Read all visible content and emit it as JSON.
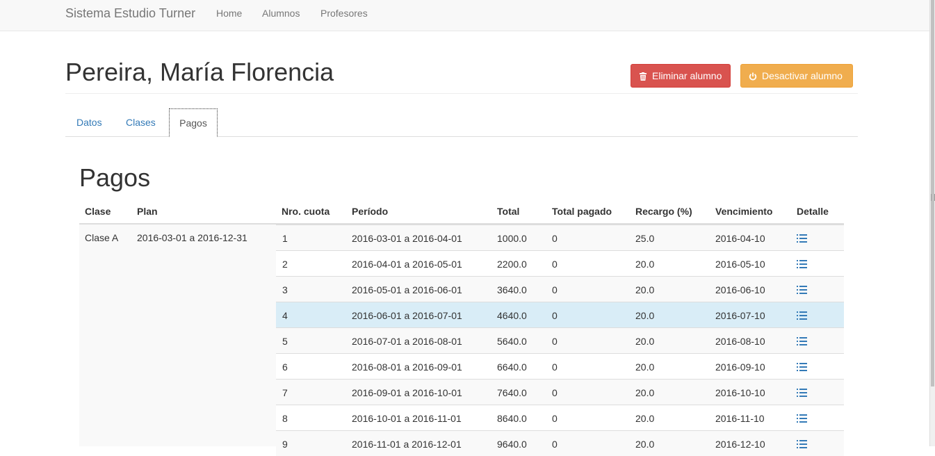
{
  "navbar": {
    "brand": "Sistema Estudio Turner",
    "links": [
      "Home",
      "Alumnos",
      "Profesores"
    ]
  },
  "header": {
    "title": "Pereira, María Florencia",
    "delete_label": "Eliminar alumno",
    "deactivate_label": "Desactivar alumno"
  },
  "tabs": [
    "Datos",
    "Clases",
    "Pagos"
  ],
  "active_tab": "Pagos",
  "section_title": "Pagos",
  "table": {
    "headers": [
      "Clase",
      "Plan",
      "Nro. cuota",
      "Período",
      "Total",
      "Total pagado",
      "Recargo (%)",
      "Vencimiento",
      "Detalle"
    ],
    "clase": "Clase A",
    "plan": "2016-03-01 a 2016-12-31",
    "rows": [
      {
        "nro": "1",
        "periodo": "2016-03-01 a 2016-04-01",
        "total": "1000.0",
        "pagado": "0",
        "recargo": "25.0",
        "vencimiento": "2016-04-10"
      },
      {
        "nro": "2",
        "periodo": "2016-04-01 a 2016-05-01",
        "total": "2200.0",
        "pagado": "0",
        "recargo": "20.0",
        "vencimiento": "2016-05-10"
      },
      {
        "nro": "3",
        "periodo": "2016-05-01 a 2016-06-01",
        "total": "3640.0",
        "pagado": "0",
        "recargo": "20.0",
        "vencimiento": "2016-06-10"
      },
      {
        "nro": "4",
        "periodo": "2016-06-01 a 2016-07-01",
        "total": "4640.0",
        "pagado": "0",
        "recargo": "20.0",
        "vencimiento": "2016-07-10"
      },
      {
        "nro": "5",
        "periodo": "2016-07-01 a 2016-08-01",
        "total": "5640.0",
        "pagado": "0",
        "recargo": "20.0",
        "vencimiento": "2016-08-10"
      },
      {
        "nro": "6",
        "periodo": "2016-08-01 a 2016-09-01",
        "total": "6640.0",
        "pagado": "0",
        "recargo": "20.0",
        "vencimiento": "2016-09-10"
      },
      {
        "nro": "7",
        "periodo": "2016-09-01 a 2016-10-01",
        "total": "7640.0",
        "pagado": "0",
        "recargo": "20.0",
        "vencimiento": "2016-10-10"
      },
      {
        "nro": "8",
        "periodo": "2016-10-01 a 2016-11-01",
        "total": "8640.0",
        "pagado": "0",
        "recargo": "20.0",
        "vencimiento": "2016-11-10"
      },
      {
        "nro": "9",
        "periodo": "2016-11-01 a 2016-12-01",
        "total": "9640.0",
        "pagado": "0",
        "recargo": "20.0",
        "vencimiento": "2016-12-10"
      }
    ],
    "highlighted_row": "4",
    "detail_icon": "list-icon"
  },
  "colors": {
    "danger": "#d9534f",
    "warning": "#f0ad4e",
    "link": "#337ab7",
    "highlight": "#d9edf7"
  }
}
